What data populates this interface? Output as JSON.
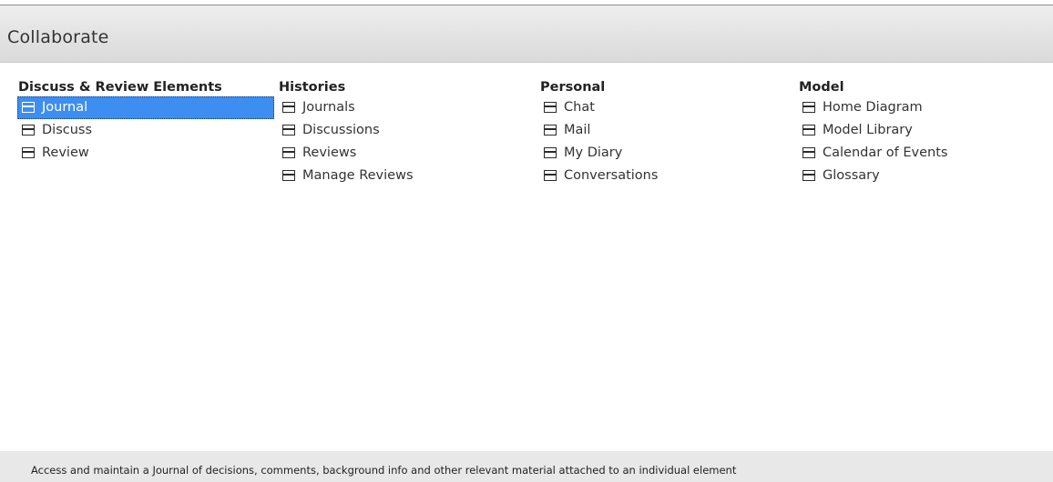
{
  "header": {
    "title": "Collaborate"
  },
  "columns": [
    {
      "title": "Discuss & Review Elements",
      "items": [
        {
          "label": "Journal",
          "icon": "list-icon",
          "selected": true
        },
        {
          "label": "Discuss",
          "icon": "list-icon"
        },
        {
          "label": "Review",
          "icon": "list-icon"
        }
      ]
    },
    {
      "title": "Histories",
      "items": [
        {
          "label": "Journals",
          "icon": "list-icon"
        },
        {
          "label": "Discussions",
          "icon": "list-icon"
        },
        {
          "label": "Reviews",
          "icon": "list-icon"
        },
        {
          "label": "Manage Reviews",
          "icon": "list-icon"
        }
      ]
    },
    {
      "title": "Personal",
      "items": [
        {
          "label": "Chat",
          "icon": "list-icon"
        },
        {
          "label": "Mail",
          "icon": "list-icon"
        },
        {
          "label": "My Diary",
          "icon": "list-icon"
        },
        {
          "label": "Conversations",
          "icon": "list-icon"
        }
      ]
    },
    {
      "title": "Model",
      "items": [
        {
          "label": "Home Diagram",
          "icon": "list-icon"
        },
        {
          "label": "Model Library",
          "icon": "list-icon"
        },
        {
          "label": "Calendar of Events",
          "icon": "list-icon"
        },
        {
          "label": "Glossary",
          "icon": "list-icon"
        }
      ]
    }
  ],
  "footer": {
    "description": "Access and maintain a Journal of decisions, comments, background info and other relevant material attached to an individual element"
  },
  "colors": {
    "selection": "#3d8ef0",
    "header_bg": "#e2e2e2",
    "footer_bg": "#e8e8e8"
  }
}
